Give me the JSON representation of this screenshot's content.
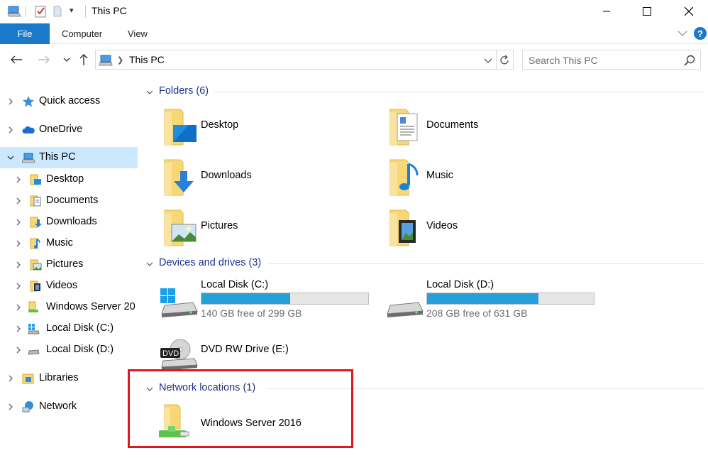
{
  "window": {
    "title": "This PC",
    "quick_access_dropdown_glyph": "▾"
  },
  "ribbon": {
    "tabs": [
      {
        "label": "File"
      },
      {
        "label": "Computer"
      },
      {
        "label": "View"
      }
    ],
    "help_glyph": "?"
  },
  "address": {
    "breadcrumb": "This PC"
  },
  "search": {
    "placeholder": "Search This PC"
  },
  "nav": {
    "items": [
      {
        "label": "Quick access",
        "icon": "star-icon"
      },
      {
        "label": "OneDrive",
        "icon": "cloud-icon"
      },
      {
        "label": "This PC",
        "icon": "computer-icon",
        "selected": true
      },
      {
        "label": "Desktop",
        "icon": "folder-desktop-icon"
      },
      {
        "label": "Documents",
        "icon": "folder-documents-icon"
      },
      {
        "label": "Downloads",
        "icon": "folder-downloads-icon"
      },
      {
        "label": "Music",
        "icon": "folder-music-icon"
      },
      {
        "label": "Pictures",
        "icon": "folder-pictures-icon"
      },
      {
        "label": "Videos",
        "icon": "folder-videos-icon"
      },
      {
        "label": "Windows Server 20",
        "icon": "network-folder-icon"
      },
      {
        "label": "Local Disk (C:)",
        "icon": "system-drive-icon"
      },
      {
        "label": "Local Disk (D:)",
        "icon": "drive-icon"
      },
      {
        "label": "Libraries",
        "icon": "libraries-icon"
      },
      {
        "label": "Network",
        "icon": "network-icon"
      }
    ]
  },
  "groups": {
    "folders": {
      "title": "Folders (6)",
      "items": [
        {
          "name": "Desktop"
        },
        {
          "name": "Documents"
        },
        {
          "name": "Downloads"
        },
        {
          "name": "Music"
        },
        {
          "name": "Pictures"
        },
        {
          "name": "Videos"
        }
      ]
    },
    "drives": {
      "title": "Devices and drives (3)",
      "items": [
        {
          "name": "Local Disk (C:)",
          "free": "140 GB free of 299 GB",
          "used_fraction": 0.532
        },
        {
          "name": "Local Disk (D:)",
          "free": "208 GB free of 631 GB",
          "used_fraction": 0.67
        },
        {
          "name": "DVD RW Drive (E:)"
        }
      ],
      "dvd_label": "DVD"
    },
    "network": {
      "title": "Network locations (1)",
      "items": [
        {
          "name": "Windows Server 2016"
        }
      ]
    }
  },
  "colors": {
    "accent": "#1979ca",
    "selection": "#cce8ff",
    "capacity_bar": "#26a0da",
    "group_title": "#1e3287",
    "highlight_box": "#e3161e",
    "folder": "#f8d775"
  }
}
